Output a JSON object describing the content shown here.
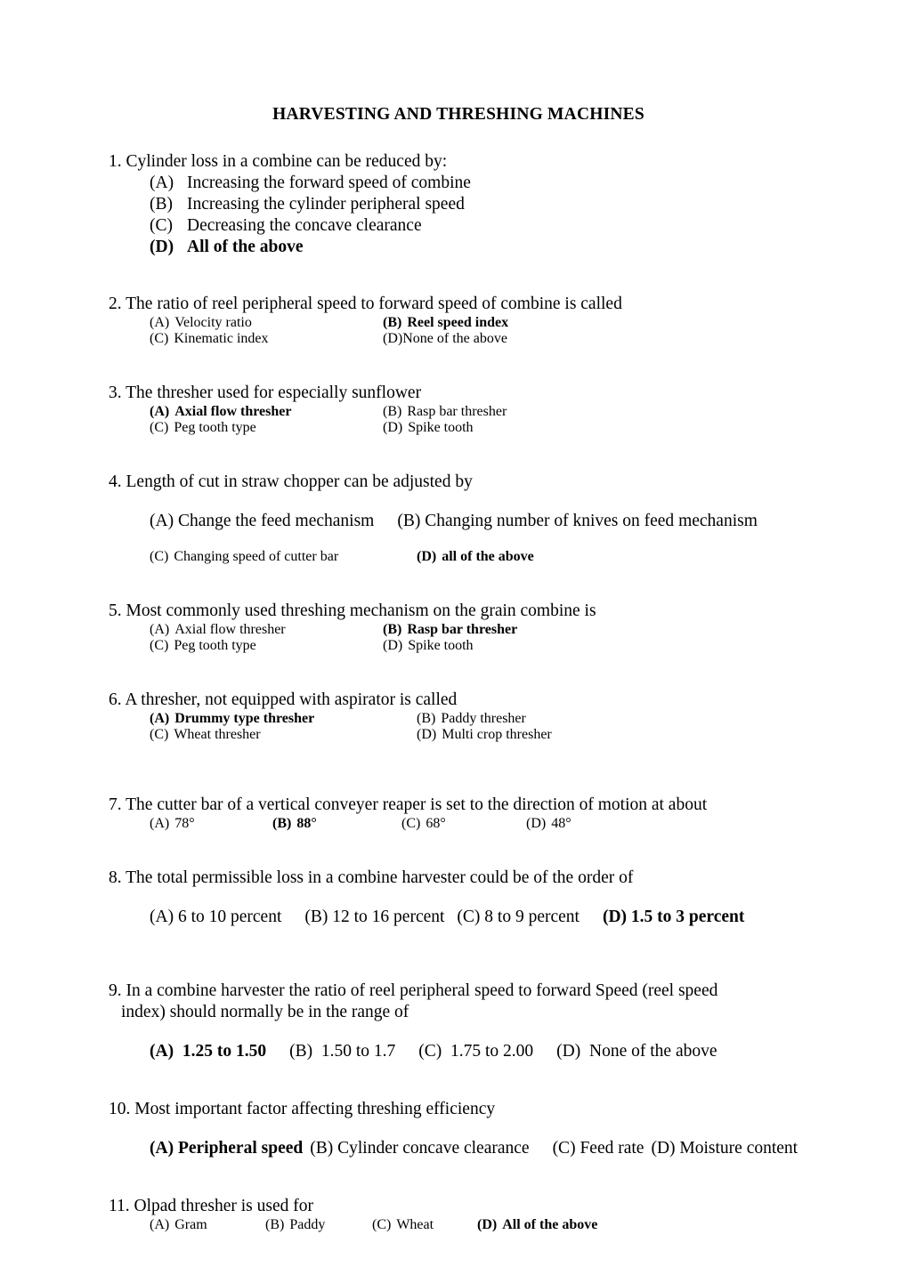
{
  "document": {
    "title": "HARVESTING AND THRESHING MACHINES"
  },
  "questions": [
    {
      "number": "1.",
      "stem": "1. Cylinder loss in a combine can be reduced by:",
      "layout": "stack",
      "options": [
        {
          "label": "(A)",
          "text": "Increasing the forward speed of combine",
          "bold": false
        },
        {
          "label": "(B)",
          "text": "Increasing the cylinder peripheral speed",
          "bold": false
        },
        {
          "label": "(C)",
          "text": "Decreasing the concave clearance",
          "bold": false
        },
        {
          "label": "(D)",
          "text": "All of the above",
          "bold": true
        }
      ]
    },
    {
      "number": "2.",
      "stem": " 2. The ratio of reel peripheral speed to forward speed of combine is called",
      "layout": "two-column",
      "options": [
        {
          "label": "(A)",
          "text": "Velocity ratio",
          "bold": false
        },
        {
          "label": "(B)",
          "text": "Reel speed index",
          "bold": true
        },
        {
          "label": "(C)",
          "text": "Kinematic index",
          "bold": false
        },
        {
          "label": "(D)",
          "text": "None of the above",
          "bold": false,
          "tight": true
        }
      ]
    },
    {
      "number": "3.",
      "stem": "3. The thresher used for especially sunflower",
      "layout": "two-column",
      "options": [
        {
          "label": "(A)",
          "text": "Axial flow thresher",
          "bold": true
        },
        {
          "label": "(B)",
          "text": "Rasp bar thresher",
          "bold": false
        },
        {
          "label": "(C)",
          "text": "Peg tooth type",
          "bold": false
        },
        {
          "label": "(D)",
          "text": "Spike tooth",
          "bold": false
        }
      ]
    },
    {
      "number": "4.",
      "stem": "4. Length of cut in straw chopper can be adjusted by",
      "layout": "flow",
      "options": [
        {
          "label": "(A)",
          "text": "Change the feed mechanism",
          "bold": false
        },
        {
          "label": "(B)",
          "text": "Changing number of knives on feed",
          "bold": false
        },
        {
          "label": "",
          "text": "mechanism",
          "bold": false
        },
        {
          "label": "(C)",
          "text": "Changing speed of cutter bar",
          "bold": false
        },
        {
          "label": "(D)",
          "text": "all of the above",
          "bold": true
        }
      ]
    },
    {
      "number": "5.",
      "stem": "5. Most commonly used threshing mechanism on the grain combine is",
      "layout": "two-column",
      "options": [
        {
          "label": "(A)",
          "text": "Axial flow thresher",
          "bold": false
        },
        {
          "label": "(B)",
          "text": "Rasp bar thresher",
          "bold": true
        },
        {
          "label": "(C)",
          "text": "Peg tooth type",
          "bold": false
        },
        {
          "label": "(D)",
          "text": "Spike tooth",
          "bold": false
        }
      ]
    },
    {
      "number": "6.",
      "stem": " 6.  A thresher, not equipped with aspirator is called",
      "layout": "two-column",
      "options": [
        {
          "label": "(A)",
          "text": "Drummy  type thresher",
          "bold": true
        },
        {
          "label": "(B)",
          "text": "Paddy thresher",
          "bold": false
        },
        {
          "label": "(C)",
          "text": "Wheat thresher",
          "bold": false
        },
        {
          "label": "(D)",
          "text": "Multi crop thresher",
          "bold": false
        }
      ]
    },
    {
      "number": "7.",
      "stem": "7.  The cutter bar of a vertical conveyer reaper is set to the direction of motion at about",
      "layout": "four-column",
      "options": [
        {
          "label": "(A)",
          "text": "78°",
          "bold": false
        },
        {
          "label": "(B)",
          "text": "88°",
          "bold": true
        },
        {
          "label": "(C)",
          "text": "68°",
          "bold": false
        },
        {
          "label": "(D)",
          "text": "48°",
          "bold": false
        }
      ]
    },
    {
      "number": "8.",
      "stem": "8. The total permissible loss in a combine harvester could be of the order of",
      "layout": "flow",
      "options": [
        {
          "label": "(A)",
          "text": "6 to 10 percent",
          "bold": false
        },
        {
          "label": "(B)",
          "text": "12 to 16 percent",
          "bold": false
        },
        {
          "label": "(C)",
          "text": "8 to 9 percent",
          "bold": false
        },
        {
          "label": "(D)",
          "text": "1.5 to 3",
          "bold": true
        },
        {
          "label": "",
          "text": "percent",
          "bold": true
        }
      ]
    },
    {
      "number": "9.",
      "stem": "9. In a combine harvester the ratio of reel peripheral speed to forward Speed (reel speed",
      "stem_cont": "index) should normally be in the range of",
      "layout": "flow",
      "options": [
        {
          "label": "(A)",
          "text": "1.25 to 1.50",
          "bold": true
        },
        {
          "label": "(B)",
          "text": "1.50 to 1.7",
          "bold": false
        },
        {
          "label": "(C)",
          "text": "1.75 to 2.00",
          "bold": false
        },
        {
          "label": "(D)",
          "text": "None of the",
          "bold": false
        },
        {
          "label": "",
          "text": "above",
          "bold": false
        }
      ]
    },
    {
      "number": "10.",
      "stem": "10. Most important factor affecting threshing efficiency",
      "layout": "flow",
      "options": [
        {
          "label": "(A)",
          "text": "Peripheral speed",
          "bold": true
        },
        {
          "label": "(B)",
          "text": "Cylinder concave clearance",
          "bold": false
        },
        {
          "label": "(C)",
          "text": "Feed rate",
          "bold": false
        },
        {
          "label": "(D)",
          "text": "",
          "bold": false
        },
        {
          "label": "",
          "text": "Moisture content",
          "bold": false
        }
      ]
    },
    {
      "number": "11.",
      "stem": "11. Olpad thresher is used for",
      "layout": "four-column",
      "options": [
        {
          "label": "(A)",
          "text": "Gram",
          "bold": false
        },
        {
          "label": "(B)",
          "text": "Paddy",
          "bold": false
        },
        {
          "label": "(C)",
          "text": "Wheat",
          "bold": false
        },
        {
          "label": "(D)",
          "text": "All of the above",
          "bold": true
        }
      ]
    }
  ]
}
